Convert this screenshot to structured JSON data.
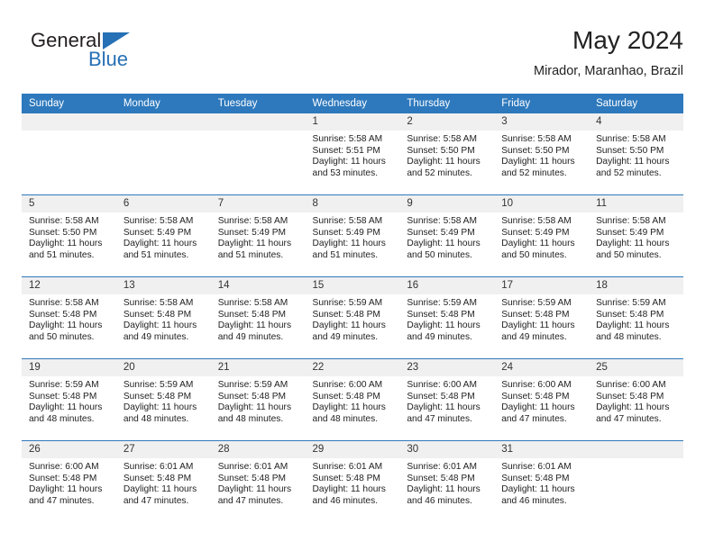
{
  "logo": {
    "word_one": "General",
    "word_two": "Blue",
    "triangle_color": "#2670b5",
    "text_color": "#231f20"
  },
  "header": {
    "title": "May 2024",
    "subtitle": "Mirador, Maranhao, Brazil"
  },
  "theme": {
    "header_bar": "#2e79bd",
    "day_strip": "#f0f0f0",
    "separator": "#2e79bd",
    "text": "#222222"
  },
  "weekday_headers": [
    "Sunday",
    "Monday",
    "Tuesday",
    "Wednesday",
    "Thursday",
    "Friday",
    "Saturday"
  ],
  "labels": {
    "sunrise_prefix": "Sunrise:",
    "sunset_prefix": "Sunset:",
    "daylight_prefix": "Daylight:"
  },
  "weeks": [
    [
      {
        "day": "",
        "sunrise": "",
        "sunset": "",
        "daylight_line1": "",
        "daylight_line2": "",
        "blank": true
      },
      {
        "day": "",
        "sunrise": "",
        "sunset": "",
        "daylight_line1": "",
        "daylight_line2": "",
        "blank": true
      },
      {
        "day": "",
        "sunrise": "",
        "sunset": "",
        "daylight_line1": "",
        "daylight_line2": "",
        "blank": true
      },
      {
        "day": "1",
        "sunrise": "Sunrise: 5:58 AM",
        "sunset": "Sunset: 5:51 PM",
        "daylight_line1": "Daylight: 11 hours",
        "daylight_line2": "and 53 minutes.",
        "blank": false
      },
      {
        "day": "2",
        "sunrise": "Sunrise: 5:58 AM",
        "sunset": "Sunset: 5:50 PM",
        "daylight_line1": "Daylight: 11 hours",
        "daylight_line2": "and 52 minutes.",
        "blank": false
      },
      {
        "day": "3",
        "sunrise": "Sunrise: 5:58 AM",
        "sunset": "Sunset: 5:50 PM",
        "daylight_line1": "Daylight: 11 hours",
        "daylight_line2": "and 52 minutes.",
        "blank": false
      },
      {
        "day": "4",
        "sunrise": "Sunrise: 5:58 AM",
        "sunset": "Sunset: 5:50 PM",
        "daylight_line1": "Daylight: 11 hours",
        "daylight_line2": "and 52 minutes.",
        "blank": false
      }
    ],
    [
      {
        "day": "5",
        "sunrise": "Sunrise: 5:58 AM",
        "sunset": "Sunset: 5:50 PM",
        "daylight_line1": "Daylight: 11 hours",
        "daylight_line2": "and 51 minutes.",
        "blank": false
      },
      {
        "day": "6",
        "sunrise": "Sunrise: 5:58 AM",
        "sunset": "Sunset: 5:49 PM",
        "daylight_line1": "Daylight: 11 hours",
        "daylight_line2": "and 51 minutes.",
        "blank": false
      },
      {
        "day": "7",
        "sunrise": "Sunrise: 5:58 AM",
        "sunset": "Sunset: 5:49 PM",
        "daylight_line1": "Daylight: 11 hours",
        "daylight_line2": "and 51 minutes.",
        "blank": false
      },
      {
        "day": "8",
        "sunrise": "Sunrise: 5:58 AM",
        "sunset": "Sunset: 5:49 PM",
        "daylight_line1": "Daylight: 11 hours",
        "daylight_line2": "and 51 minutes.",
        "blank": false
      },
      {
        "day": "9",
        "sunrise": "Sunrise: 5:58 AM",
        "sunset": "Sunset: 5:49 PM",
        "daylight_line1": "Daylight: 11 hours",
        "daylight_line2": "and 50 minutes.",
        "blank": false
      },
      {
        "day": "10",
        "sunrise": "Sunrise: 5:58 AM",
        "sunset": "Sunset: 5:49 PM",
        "daylight_line1": "Daylight: 11 hours",
        "daylight_line2": "and 50 minutes.",
        "blank": false
      },
      {
        "day": "11",
        "sunrise": "Sunrise: 5:58 AM",
        "sunset": "Sunset: 5:49 PM",
        "daylight_line1": "Daylight: 11 hours",
        "daylight_line2": "and 50 minutes.",
        "blank": false
      }
    ],
    [
      {
        "day": "12",
        "sunrise": "Sunrise: 5:58 AM",
        "sunset": "Sunset: 5:48 PM",
        "daylight_line1": "Daylight: 11 hours",
        "daylight_line2": "and 50 minutes.",
        "blank": false
      },
      {
        "day": "13",
        "sunrise": "Sunrise: 5:58 AM",
        "sunset": "Sunset: 5:48 PM",
        "daylight_line1": "Daylight: 11 hours",
        "daylight_line2": "and 49 minutes.",
        "blank": false
      },
      {
        "day": "14",
        "sunrise": "Sunrise: 5:58 AM",
        "sunset": "Sunset: 5:48 PM",
        "daylight_line1": "Daylight: 11 hours",
        "daylight_line2": "and 49 minutes.",
        "blank": false
      },
      {
        "day": "15",
        "sunrise": "Sunrise: 5:59 AM",
        "sunset": "Sunset: 5:48 PM",
        "daylight_line1": "Daylight: 11 hours",
        "daylight_line2": "and 49 minutes.",
        "blank": false
      },
      {
        "day": "16",
        "sunrise": "Sunrise: 5:59 AM",
        "sunset": "Sunset: 5:48 PM",
        "daylight_line1": "Daylight: 11 hours",
        "daylight_line2": "and 49 minutes.",
        "blank": false
      },
      {
        "day": "17",
        "sunrise": "Sunrise: 5:59 AM",
        "sunset": "Sunset: 5:48 PM",
        "daylight_line1": "Daylight: 11 hours",
        "daylight_line2": "and 49 minutes.",
        "blank": false
      },
      {
        "day": "18",
        "sunrise": "Sunrise: 5:59 AM",
        "sunset": "Sunset: 5:48 PM",
        "daylight_line1": "Daylight: 11 hours",
        "daylight_line2": "and 48 minutes.",
        "blank": false
      }
    ],
    [
      {
        "day": "19",
        "sunrise": "Sunrise: 5:59 AM",
        "sunset": "Sunset: 5:48 PM",
        "daylight_line1": "Daylight: 11 hours",
        "daylight_line2": "and 48 minutes.",
        "blank": false
      },
      {
        "day": "20",
        "sunrise": "Sunrise: 5:59 AM",
        "sunset": "Sunset: 5:48 PM",
        "daylight_line1": "Daylight: 11 hours",
        "daylight_line2": "and 48 minutes.",
        "blank": false
      },
      {
        "day": "21",
        "sunrise": "Sunrise: 5:59 AM",
        "sunset": "Sunset: 5:48 PM",
        "daylight_line1": "Daylight: 11 hours",
        "daylight_line2": "and 48 minutes.",
        "blank": false
      },
      {
        "day": "22",
        "sunrise": "Sunrise: 6:00 AM",
        "sunset": "Sunset: 5:48 PM",
        "daylight_line1": "Daylight: 11 hours",
        "daylight_line2": "and 48 minutes.",
        "blank": false
      },
      {
        "day": "23",
        "sunrise": "Sunrise: 6:00 AM",
        "sunset": "Sunset: 5:48 PM",
        "daylight_line1": "Daylight: 11 hours",
        "daylight_line2": "and 47 minutes.",
        "blank": false
      },
      {
        "day": "24",
        "sunrise": "Sunrise: 6:00 AM",
        "sunset": "Sunset: 5:48 PM",
        "daylight_line1": "Daylight: 11 hours",
        "daylight_line2": "and 47 minutes.",
        "blank": false
      },
      {
        "day": "25",
        "sunrise": "Sunrise: 6:00 AM",
        "sunset": "Sunset: 5:48 PM",
        "daylight_line1": "Daylight: 11 hours",
        "daylight_line2": "and 47 minutes.",
        "blank": false
      }
    ],
    [
      {
        "day": "26",
        "sunrise": "Sunrise: 6:00 AM",
        "sunset": "Sunset: 5:48 PM",
        "daylight_line1": "Daylight: 11 hours",
        "daylight_line2": "and 47 minutes.",
        "blank": false
      },
      {
        "day": "27",
        "sunrise": "Sunrise: 6:01 AM",
        "sunset": "Sunset: 5:48 PM",
        "daylight_line1": "Daylight: 11 hours",
        "daylight_line2": "and 47 minutes.",
        "blank": false
      },
      {
        "day": "28",
        "sunrise": "Sunrise: 6:01 AM",
        "sunset": "Sunset: 5:48 PM",
        "daylight_line1": "Daylight: 11 hours",
        "daylight_line2": "and 47 minutes.",
        "blank": false
      },
      {
        "day": "29",
        "sunrise": "Sunrise: 6:01 AM",
        "sunset": "Sunset: 5:48 PM",
        "daylight_line1": "Daylight: 11 hours",
        "daylight_line2": "and 46 minutes.",
        "blank": false
      },
      {
        "day": "30",
        "sunrise": "Sunrise: 6:01 AM",
        "sunset": "Sunset: 5:48 PM",
        "daylight_line1": "Daylight: 11 hours",
        "daylight_line2": "and 46 minutes.",
        "blank": false
      },
      {
        "day": "31",
        "sunrise": "Sunrise: 6:01 AM",
        "sunset": "Sunset: 5:48 PM",
        "daylight_line1": "Daylight: 11 hours",
        "daylight_line2": "and 46 minutes.",
        "blank": false
      },
      {
        "day": "",
        "sunrise": "",
        "sunset": "",
        "daylight_line1": "",
        "daylight_line2": "",
        "blank": true
      }
    ]
  ]
}
